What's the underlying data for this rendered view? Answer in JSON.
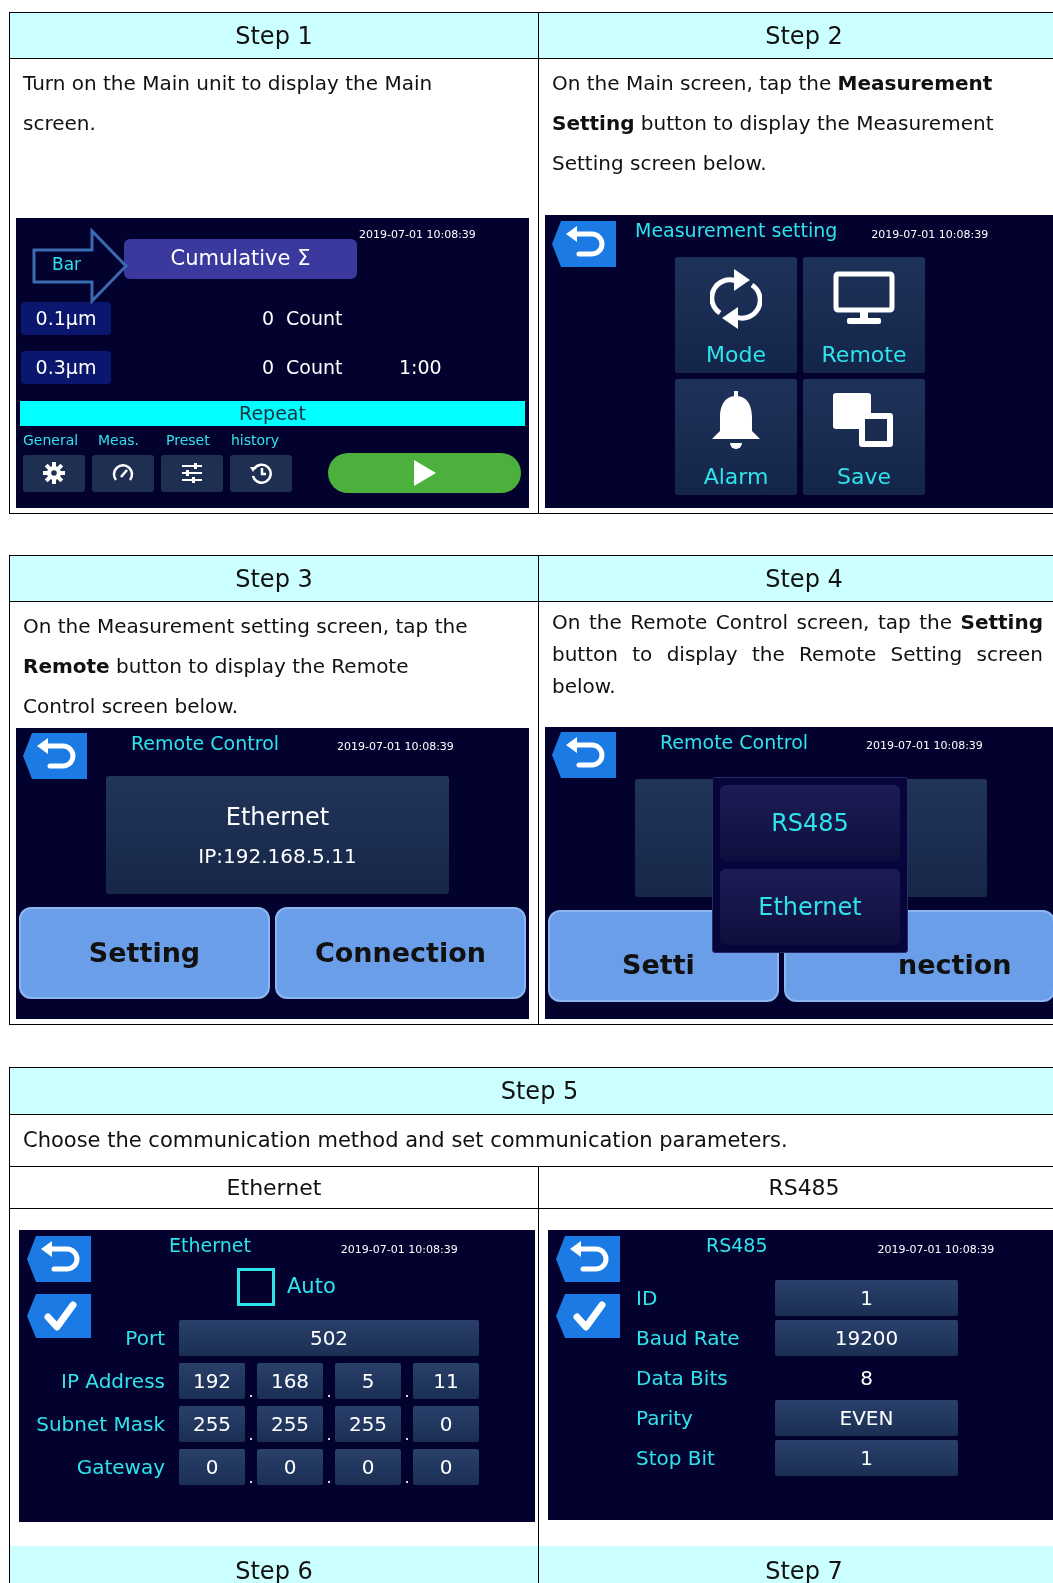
{
  "sections": [
    {
      "kind": "pair",
      "steps": [
        {
          "title": "Step 1",
          "text": "Turn on the Main unit to display the Main screen.",
          "justified": false,
          "screen": {
            "kind": "main",
            "datetime": "2019-07-01 10:08:39",
            "bar": "Bar",
            "mode": "Cumulative Σ",
            "rows": [
              {
                "size": "0.1µm",
                "count": "0",
                "unit": "Count"
              },
              {
                "size": "0.3µm",
                "count": "0",
                "unit": "Count",
                "time": "1:00"
              }
            ],
            "status": "Repeat",
            "tabs": [
              "General",
              "Meas.",
              "Preset",
              "history"
            ]
          }
        },
        {
          "title": "Step 2",
          "text": "On the Main screen, tap the **Measurement Setting** button to display the Measurement Setting screen below.",
          "justified": false,
          "screen": {
            "kind": "menu",
            "title": "Measurement setting",
            "datetime": "2019-07-01 10:08:39",
            "tiles": [
              "Mode",
              "Remote",
              "Alarm",
              "Save"
            ]
          }
        }
      ]
    },
    {
      "kind": "pair",
      "steps": [
        {
          "title": "Step 3",
          "text": "On the Measurement setting screen, tap the **Remote** button to display the Remote Control screen below.",
          "justified": false,
          "screen": {
            "kind": "remote",
            "title": "Remote Control",
            "datetime": "2019-07-01 10:08:39",
            "method": "Ethernet",
            "address": "IP:192.168.5.11",
            "buttons": [
              "Setting",
              "Connection"
            ]
          }
        },
        {
          "title": "Step 4",
          "text": "On the Remote Control screen, tap the **Setting** button to display the Remote Setting screen below.",
          "justified": true,
          "screen": {
            "kind": "remote_select",
            "title": "Remote Control",
            "datetime": "2019-07-01 10:08:39",
            "options": [
              "RS485",
              "Ethernet"
            ],
            "buttons": [
              "Setti",
              "nection"
            ]
          }
        }
      ]
    },
    {
      "kind": "split",
      "title": "Step 5",
      "text": "Choose the communication method and set communication parameters.",
      "columns": [
        {
          "title": "Ethernet",
          "screen": {
            "kind": "ethernet",
            "title": "Ethernet",
            "datetime": "2019-07-01 10:08:39",
            "auto": {
              "label": "Auto",
              "checked": false
            },
            "separator": ".",
            "fields": [
              {
                "label": "Port",
                "values": [
                  "502"
                ]
              },
              {
                "label": "IP Address",
                "values": [
                  "192",
                  "168",
                  "5",
                  "11"
                ]
              },
              {
                "label": "Subnet Mask",
                "values": [
                  "255",
                  "255",
                  "255",
                  "0"
                ]
              },
              {
                "label": "Gateway",
                "values": [
                  "0",
                  "0",
                  "0",
                  "0"
                ]
              }
            ]
          }
        },
        {
          "title": "RS485",
          "screen": {
            "kind": "rs485",
            "title": "RS485",
            "datetime": "2019-07-01 10:08:39",
            "fields": [
              {
                "label": "ID",
                "value": "1",
                "boxed": true
              },
              {
                "label": "Baud Rate",
                "value": "19200",
                "boxed": true
              },
              {
                "label": "Data Bits",
                "value": "8",
                "boxed": false
              },
              {
                "label": "Parity",
                "value": "EVEN",
                "boxed": true
              },
              {
                "label": "Stop Bit",
                "value": "1",
                "boxed": true
              }
            ]
          }
        }
      ],
      "next": [
        "Step 6",
        "Step 7"
      ]
    }
  ]
}
